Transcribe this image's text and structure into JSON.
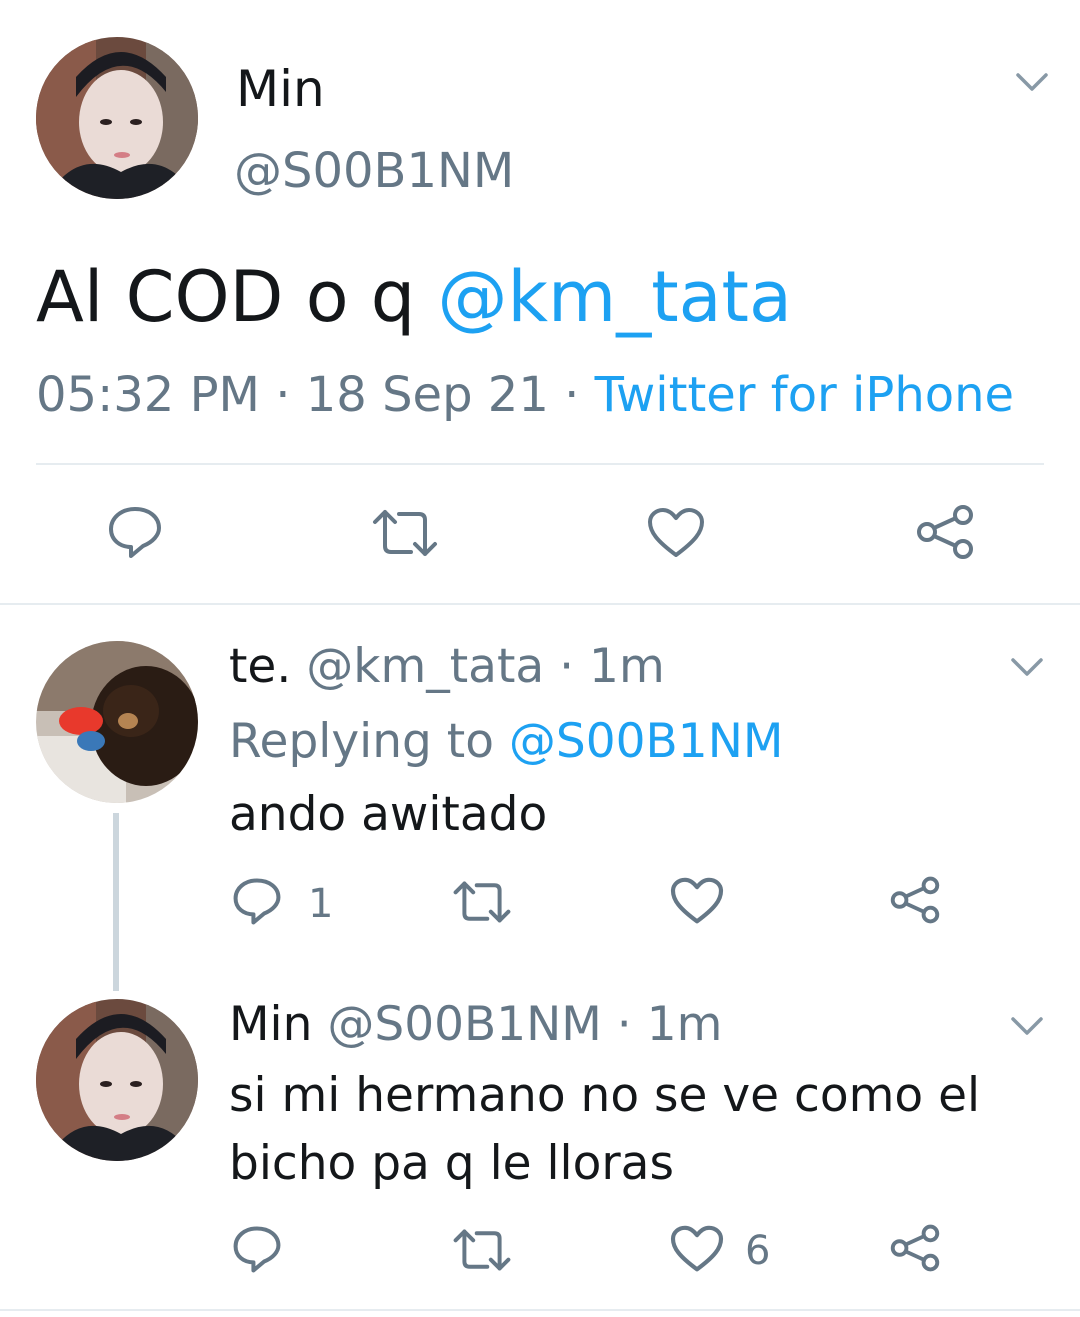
{
  "main_tweet": {
    "name": "Min",
    "handle": "@S00B1NM",
    "text_plain": "Al COD o q ",
    "text_mention": "@km_tata",
    "time": "05:32 PM",
    "sep1": " · ",
    "date": "18 Sep 21",
    "sep2": " · ",
    "source": "Twitter for iPhone"
  },
  "reply1": {
    "name": "te.",
    "handle": "@km_tata",
    "sep": " · ",
    "age": "1m",
    "replying_prefix": "Replying to ",
    "replying_handle": "@S00B1NM",
    "text": "ando awitado",
    "reply_count": "1",
    "like_count": ""
  },
  "reply2": {
    "name": "Min",
    "handle": "@S00B1NM",
    "sep": " · ",
    "age": "1m",
    "text_line1": "si mi hermano no se ve como el",
    "text_line2": "bicho pa q le lloras",
    "like_count": "6"
  },
  "colors": {
    "accent": "#1da1f2",
    "muted": "#657786",
    "divider": "#e6ecf0",
    "thread_line": "#ccd6dd"
  },
  "icons": [
    "chevron-down-icon",
    "reply-icon",
    "retweet-icon",
    "like-icon",
    "share-icon"
  ]
}
